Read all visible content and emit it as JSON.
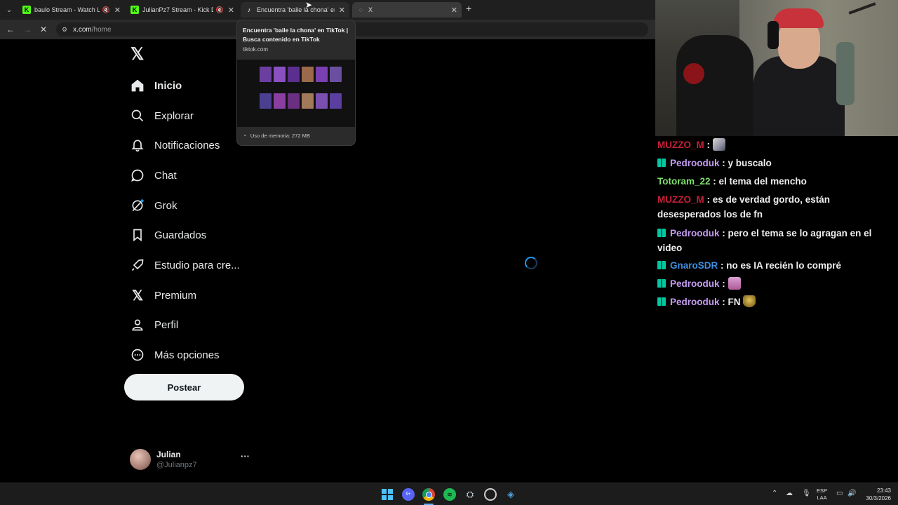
{
  "browser": {
    "tabs": [
      {
        "title": "baulo Stream - Watch Live o",
        "favicon": "kick-icon"
      },
      {
        "title": "JulianPz7 Stream - Kick Das",
        "favicon": "kick-icon"
      },
      {
        "title": "Encuentra 'baile la chona' en Ti",
        "favicon": "tiktok-icon"
      },
      {
        "title": "X",
        "favicon": "loading-icon"
      }
    ],
    "url_host": "x.com",
    "url_path": "/home",
    "hovercard": {
      "title": "Encuentra 'baile la chona' en TikTok | Busca contenido en TikTok",
      "domain": "tiktok.com",
      "memory": "Uso de memoria: 272 MB"
    }
  },
  "x": {
    "nav": [
      {
        "label": "Inicio",
        "icon": "home-icon"
      },
      {
        "label": "Explorar",
        "icon": "search-icon"
      },
      {
        "label": "Notificaciones",
        "icon": "bell-icon"
      },
      {
        "label": "Chat",
        "icon": "chat-icon"
      },
      {
        "label": "Grok",
        "icon": "grok-icon"
      },
      {
        "label": "Guardados",
        "icon": "bookmark-icon"
      },
      {
        "label": "Estudio para cre...",
        "icon": "rocket-icon"
      },
      {
        "label": "Premium",
        "icon": "x-logo-icon"
      },
      {
        "label": "Perfil",
        "icon": "person-icon"
      },
      {
        "label": "Más opciones",
        "icon": "more-circle-icon"
      }
    ],
    "post_label": "Postear",
    "account": {
      "name": "Julian",
      "handle": "@Julianpz7",
      "more": "···"
    }
  },
  "chat": {
    "messages": [
      {
        "user": "MUZZO_M",
        "color": "#c42038",
        "badge": false,
        "text": "",
        "emote": "emote-1"
      },
      {
        "user": "Pedrooduk",
        "color": "#c69df2",
        "badge": true,
        "text": "y buscalo"
      },
      {
        "user": "Totoram_22",
        "color": "#7ee06a",
        "badge": false,
        "text": "el tema del mencho"
      },
      {
        "user": "MUZZO_M",
        "color": "#c42038",
        "badge": false,
        "text": "es de verdad gordo, están desesperados los de fn"
      },
      {
        "user": "Pedrooduk",
        "color": "#c69df2",
        "badge": true,
        "text": "pero el tema se lo agragan en el video"
      },
      {
        "user": "GnaroSDR",
        "color": "#3d8ee0",
        "badge": true,
        "text": "no es IA recién lo compré"
      },
      {
        "user": "Pedrooduk",
        "color": "#c69df2",
        "badge": true,
        "text": "",
        "emote": "emote-2"
      },
      {
        "user": "Pedrooduk",
        "color": "#c69df2",
        "badge": true,
        "text": "FN",
        "emote": "emote-3"
      }
    ]
  },
  "taskbar": {
    "apps": [
      "windows-start-icon",
      "discord-icon",
      "chrome-icon",
      "spotify-icon",
      "steam-icon",
      "obs-icon",
      "app-icon"
    ],
    "discord_badge": "9+",
    "lang_top": "ESP",
    "lang_bottom": "LAA",
    "time": "23:43",
    "date": "30/3/2026"
  }
}
